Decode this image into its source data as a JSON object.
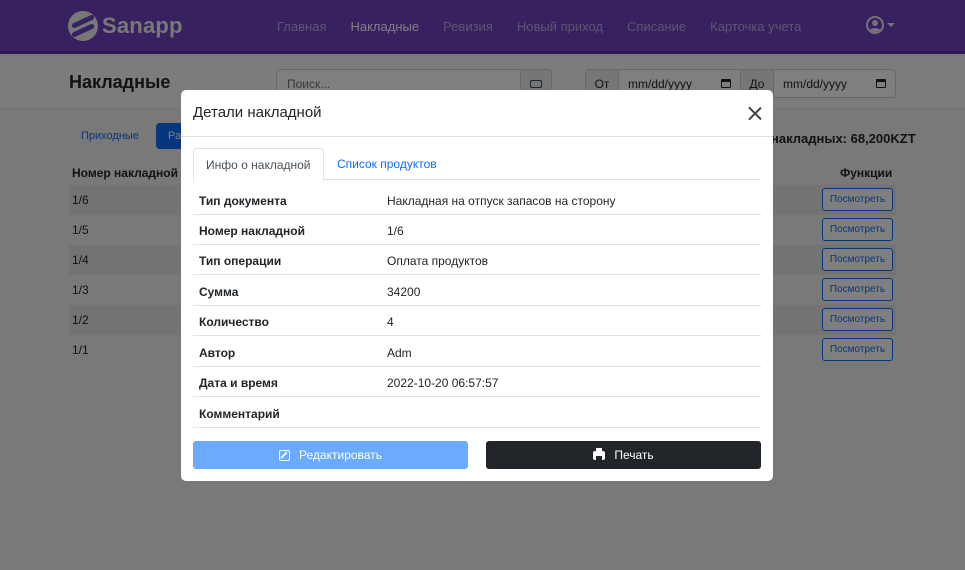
{
  "nav": {
    "brand": "Sanapp",
    "links": [
      "Главная",
      "Накладные",
      "Ревизия",
      "Новый приход",
      "Списание",
      "Карточка учета"
    ],
    "active_index": 1
  },
  "header": {
    "title": "Накладные",
    "search_placeholder": "Поиск...",
    "date_from_label": "От",
    "date_from_value": "mm/dd/yyyy",
    "date_to_label": "До",
    "date_to_value": "mm/dd/yyyy"
  },
  "filters": {
    "incoming_label": "Приходные",
    "outgoing_label": "Ра"
  },
  "summary": {
    "total_text": "накладных: 68,200KZT"
  },
  "table": {
    "col_number": "Номер накладной",
    "col_functions": "Функции",
    "view_label": "Посмотреть",
    "rows": [
      "1/6",
      "1/5",
      "1/4",
      "1/3",
      "1/2",
      "1/1"
    ]
  },
  "modal": {
    "title": "Детали накладной",
    "tabs": [
      "Инфо о накладной",
      "Список продуктов"
    ],
    "active_tab": 0,
    "details": [
      {
        "label": "Тип документа",
        "value": "Накладная на отпуск запасов на сторону"
      },
      {
        "label": "Номер накладной",
        "value": "1/6"
      },
      {
        "label": "Тип операции",
        "value": "Оплата продуктов"
      },
      {
        "label": "Сумма",
        "value": "34200"
      },
      {
        "label": "Количество",
        "value": "4"
      },
      {
        "label": "Автор",
        "value": "Adm"
      },
      {
        "label": "Дата и время",
        "value": "2022-10-20 06:57:57"
      },
      {
        "label": "Комментарий",
        "value": ""
      }
    ],
    "edit_label": "Редактировать",
    "print_label": "Печать"
  },
  "colors": {
    "navbar": "#6f42c1",
    "primary": "#0d6efd",
    "edit_button": "#6aabfd",
    "print_button": "#212529"
  }
}
